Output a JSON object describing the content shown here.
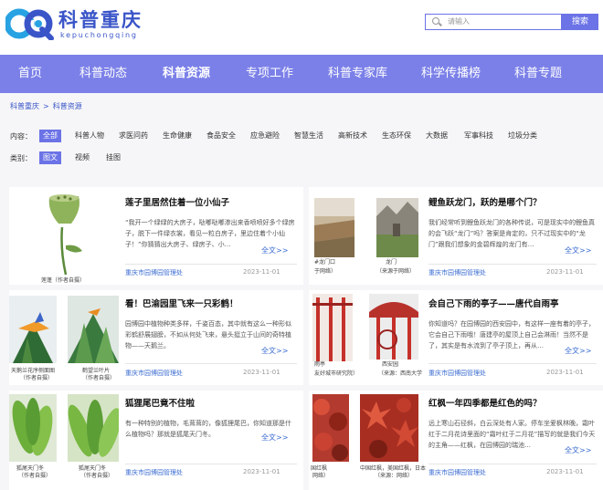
{
  "logo": {
    "cn": "科普重庆",
    "en": "kepuchongqing"
  },
  "search": {
    "placeholder": "请输入",
    "button": "搜索"
  },
  "nav": [
    "首页",
    "科普动态",
    "科普资源",
    "专项工作",
    "科普专家库",
    "科学传播榜",
    "科普专题"
  ],
  "breadcrumb": [
    "科普重庆",
    ">",
    "科普资源"
  ],
  "filters": {
    "content_label": "内容：",
    "content_options": [
      "全部",
      "科普人物",
      "求医问药",
      "生命健康",
      "食品安全",
      "应急避险",
      "智慧生活",
      "高新技术",
      "生态环保",
      "大数据",
      "军事科技",
      "垃圾分类"
    ],
    "type_label": "类别：",
    "type_options": [
      "图文",
      "视频",
      "挂图"
    ]
  },
  "cards": [
    {
      "title": "莲子里居然住着一位小仙子",
      "body": "“我开一个绿绿的大房子，哒嘟哒嘟渗出来香喷喷好多个绿房子，脱下一件绿衣裳，看见一粒白房子，里边住着个小仙子！”你猜猜出大房子、绿房子、小…",
      "more": "全文>>",
      "source": "重庆市园博园管理处",
      "date": "2023-11-01",
      "captions": [
        "莲蓬（作者自摄）"
      ]
    },
    {
      "title": "鲤鱼跃龙门，跃的是哪个门？",
      "body": "我们经常听到鲤鱼跃龙门的各种传说，可是现实中的鲤鱼真的会飞跃“龙门”吗？答案是肯定的，只不过现实中的“龙门”跟我们想象的金碧辉煌的龙门有…",
      "more": "全文>>",
      "source": "重庆市园博园管理处",
      "date": "2023-11-01",
      "captions": [
        "龙门",
        "（来源于网络）",
        "#龙门口",
        "于网络）"
      ]
    },
    {
      "title": "看！巴渝园里飞来一只彩鹤！",
      "body": "园博园中植物种类多样，千姿百态，其中就有这么一种形似彩鹤舒展翅膀，不如从何处飞来，悬头挺立于山间的奇特植物——天鹅兰。",
      "more": "全文>>",
      "source": "重庆市园博园管理处",
      "date": "2023-11-01",
      "captions": [
        "天鹅兰花序侧面图",
        "（作者自摄）",
        "鹤望兰叶片",
        "（作者自摄）"
      ]
    },
    {
      "title": "会自己下雨的亭子——唐代自雨亭",
      "body": "你知道吗？在园博园的西安园中，有这样一座有着的亭子，它会自己下雨哦！唐建亭的屋顶上自己会淋雨！当然不是了，其实是有水流到了亭子顶上，再从…",
      "more": "全文>>",
      "source": "重庆市园博园管理处",
      "date": "2023-11-01",
      "captions": [
        "西安园",
        "（来源：西南大学",
        "雨亭",
        "友好城市研究院）"
      ]
    },
    {
      "title": "狐狸尾巴竟不住啦",
      "body": "有一种特别的植物，毛茸茸的，像狐狸尾巴，你知道那是什么植物吗？那就是狐尾天门冬。",
      "more": "全文>>",
      "source": "重庆市园博园管理处",
      "date": "2023-11-01",
      "captions": [
        "狐尾天门冬",
        "（作者自摄）",
        "狐尾天门冬",
        "（作者自摄）"
      ]
    },
    {
      "title": "红枫一年四季都是红色的吗？",
      "body": "远上寒山石径斜，白云深处有人家。停车坐爱枫林晚，霜叶红于二月花诗里面的“霜叶红于二月花”描写的就是我们今天的主角——红枫，在园博园的瑞池…",
      "more": "全文>>",
      "source": "重庆市园博园管理处",
      "date": "2023-11-01",
      "captions": [
        "中国红枫，美国红枫，日本",
        "（来源：网络）",
        "国红枫",
        "网络）"
      ]
    }
  ],
  "colors": {
    "brand": "#3a55c8",
    "nav": "#7b80e8",
    "accent": "#6b73e6"
  }
}
